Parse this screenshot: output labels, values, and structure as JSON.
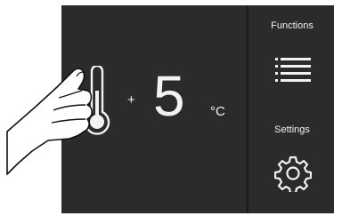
{
  "display": {
    "temperature": {
      "sign": "+",
      "value": "5",
      "unit": "°C",
      "icon": "thermometer-icon"
    },
    "sidebar": {
      "functions": {
        "label": "Functions",
        "icon": "menu-list-icon"
      },
      "settings": {
        "label": "Settings",
        "icon": "gear-icon"
      }
    }
  },
  "colors": {
    "screen": "#2b2b2b",
    "foreground": "#f2f2f2"
  }
}
